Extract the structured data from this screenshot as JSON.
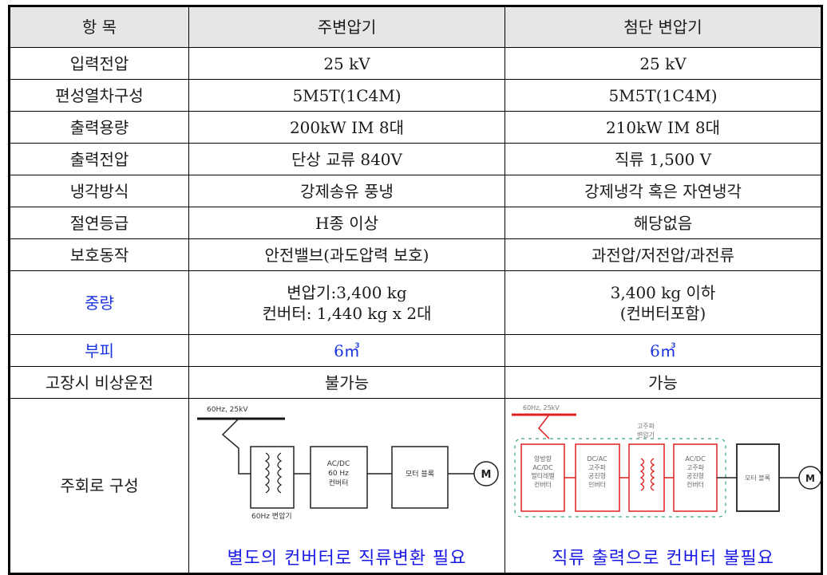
{
  "table": {
    "headers": [
      "항 목",
      "주변압기",
      "첨단 변압기"
    ],
    "rows": [
      {
        "item": "입력전압",
        "conventional": "25 kV",
        "advanced": "25 kV"
      },
      {
        "item": "편성열차구성",
        "conventional": "5M5T(1C4M)",
        "advanced": "5M5T(1C4M)"
      },
      {
        "item": "출력용량",
        "conventional": "200kW IM 8대",
        "advanced": "210kW IM 8대"
      },
      {
        "item": "출력전압",
        "conventional": "단상 교류 840V",
        "advanced": "직류 1,500 V"
      },
      {
        "item": "냉각방식",
        "conventional": "강제송유 풍냉",
        "advanced": "강제냉각 혹은 자연냉각"
      },
      {
        "item": "절연등급",
        "conventional": "H종 이상",
        "advanced": "해당없음"
      },
      {
        "item": "보호동작",
        "conventional": "안전밸브(과도압력 보호)",
        "advanced": "과전압/저전압/과전류"
      },
      {
        "item": "중량",
        "conventional": [
          "변압기:3,400 kg",
          "컨버터: 1,440 kg x 2대"
        ],
        "advanced": [
          "3,400 kg 이하",
          "(컨버터포함)"
        ]
      },
      {
        "item": "부피",
        "conventional": "6㎥",
        "advanced": "6㎥"
      },
      {
        "item": "고장시 비상운전",
        "conventional": "불가능",
        "advanced": "가능"
      }
    ],
    "diagram_row": {
      "item": "주회로 구성",
      "conventional": {
        "supply_label": "60Hz, 25kV",
        "transformer_label": "60Hz 변압기",
        "blocks": [
          "AC/DC\n60 Hz\n컨버터",
          "모터 블록"
        ],
        "motor_label": "M",
        "note": "별도의 컨버터로 직류변환 필요"
      },
      "advanced": {
        "supply_label": "60Hz, 25kV",
        "hf_transformer_label": "고주파\n변압기",
        "blocks": [
          "양방향\nAC/DC\n멀티레벨\n컨버터",
          "DC/AC\n고주파\n공진형\n인버터",
          "AC/DC\n고주파\n공진형\n컨버터",
          "모터 블록"
        ],
        "motor_label": "M",
        "note": "직류 출력으로 컨버터 불필요"
      }
    },
    "colors": {
      "header_bg": "#e6e6e6",
      "highlight_text": "#1a33e0",
      "advanced_block": "#e02020",
      "group_outline": "#3aa87a"
    }
  }
}
